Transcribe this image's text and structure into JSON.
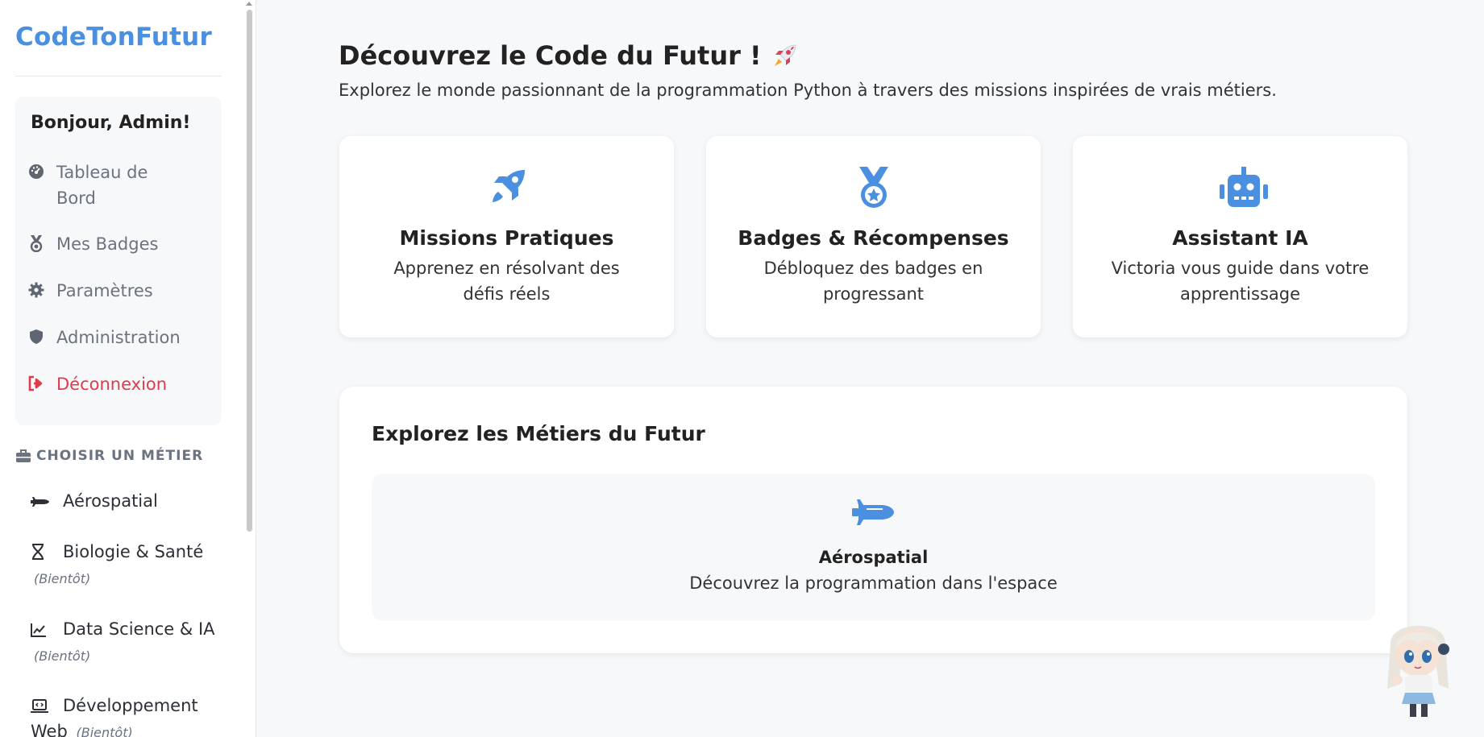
{
  "sidebar": {
    "brand": "CodeTonFutur",
    "greeting": "Bonjour, Admin!",
    "nav": [
      {
        "label": "Tableau de Bord",
        "icon": "gauge-icon"
      },
      {
        "label": "Mes Badges",
        "icon": "medal-icon"
      },
      {
        "label": "Paramètres",
        "icon": "gear-icon"
      },
      {
        "label": "Administration",
        "icon": "shield-icon"
      },
      {
        "label": "Déconnexion",
        "icon": "logout-icon"
      }
    ],
    "section_title": "CHOISIR UN MÉTIER",
    "jobs": [
      {
        "label": "Aérospatial",
        "soon": "",
        "icon": "shuttle-icon"
      },
      {
        "label": "Biologie & Santé",
        "soon": "(Bientôt)",
        "icon": "dna-icon"
      },
      {
        "label": "Data Science & IA",
        "soon": "(Bientôt)",
        "icon": "chart-line-icon"
      },
      {
        "label": "Développement Web",
        "soon": "(Bientôt)",
        "icon": "laptop-code-icon"
      }
    ]
  },
  "main": {
    "title": "Découvrez le Code du Futur !",
    "subtitle": "Explorez le monde passionnant de la programmation Python à travers des missions inspirées de vrais métiers.",
    "features": [
      {
        "title": "Missions Pratiques",
        "desc": "Apprenez en résolvant des défis réels",
        "icon": "rocket-icon"
      },
      {
        "title": "Badges & Récompenses",
        "desc": "Débloquez des badges en progressant",
        "icon": "medal-icon"
      },
      {
        "title": "Assistant IA",
        "desc": "Victoria vous guide dans votre apprentissage",
        "icon": "robot-icon"
      }
    ],
    "jobs_section": {
      "title": "Explorez les Métiers du Futur",
      "card": {
        "title": "Aérospatial",
        "desc": "Découvrez la programmation dans l'espace",
        "icon": "shuttle-icon"
      }
    }
  },
  "colors": {
    "accent": "#4a8fe0",
    "danger": "#e03b4b",
    "background": "#f7f8fa"
  }
}
